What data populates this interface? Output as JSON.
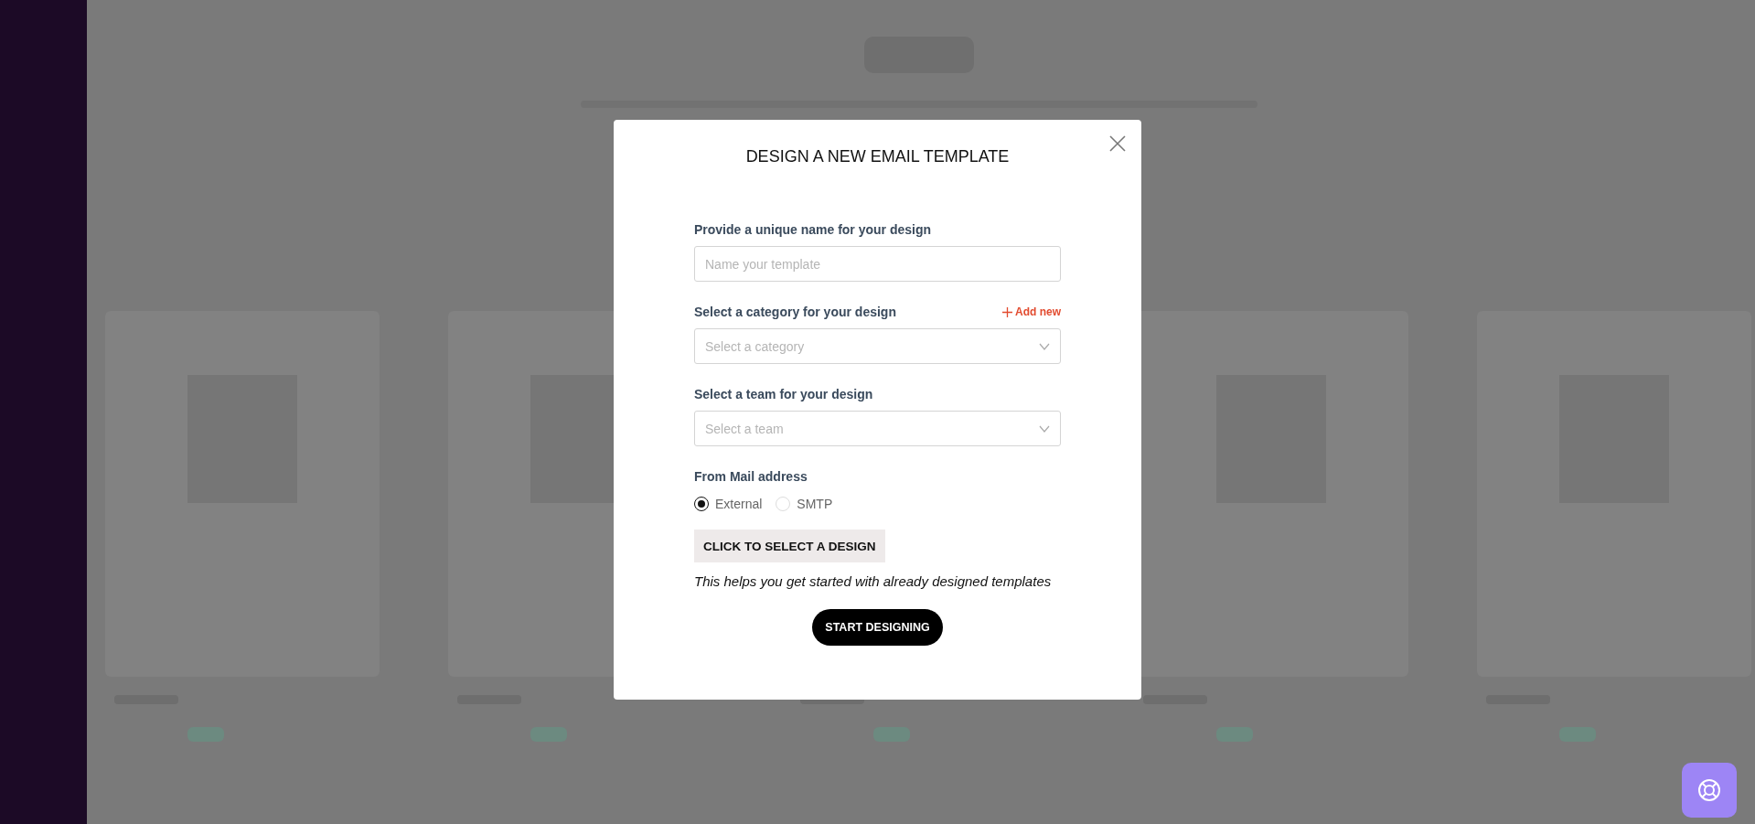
{
  "dialog": {
    "title": "DESIGN A NEW EMAIL TEMPLATE",
    "name_field": {
      "label": "Provide a unique name for your design",
      "placeholder": "Name your template"
    },
    "category_field": {
      "label": "Select a category for your design",
      "add_link": "Add new",
      "placeholder": "Select a category"
    },
    "team_field": {
      "label": "Select a team for your design",
      "placeholder": "Select a team"
    },
    "from_mail": {
      "label": "From Mail address",
      "options": [
        {
          "label": "External",
          "selected": true
        },
        {
          "label": "SMTP",
          "selected": false
        }
      ]
    },
    "design_button": "CLICK TO SELECT A DESIGN",
    "hint": "This helps you get started with already designed templates",
    "start_button": "START DESIGNING"
  }
}
